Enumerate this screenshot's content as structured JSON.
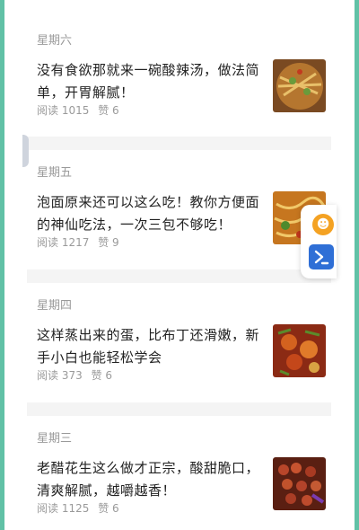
{
  "feed": [
    {
      "day": "星期六",
      "title": "没有食欲那就来一碗酸辣汤，做法简单，开胃解腻！",
      "read": "阅读 1015",
      "likes": "赞 6",
      "thumb": "hot-sour-soup-image"
    },
    {
      "day": "星期五",
      "title": "泡面原来还可以这么吃！教你方便面的神仙吃法，一次三包不够吃！",
      "read": "阅读 1217",
      "likes": "赞 9",
      "thumb": "instant-noodles-image"
    },
    {
      "day": "星期四",
      "title": "这样蒸出来的蛋，比布丁还滑嫩，新手小白也能轻松学会",
      "read": "阅读 373",
      "likes": "赞 6",
      "thumb": "steamed-egg-image"
    },
    {
      "day": "星期三",
      "title": "老醋花生这么做才正宗，酸甜脆口，清爽解腻，越嚼越香！",
      "read": "阅读 1125",
      "likes": "赞 6",
      "thumb": "vinegar-peanuts-image"
    }
  ],
  "colors": {
    "frame": "#61c1a6",
    "title": "#222222",
    "meta": "#9a9a9a",
    "divider": "#f4f4f4"
  },
  "floating_tools": {
    "icons": [
      "accessibility-icon",
      "terminal-icon"
    ]
  }
}
